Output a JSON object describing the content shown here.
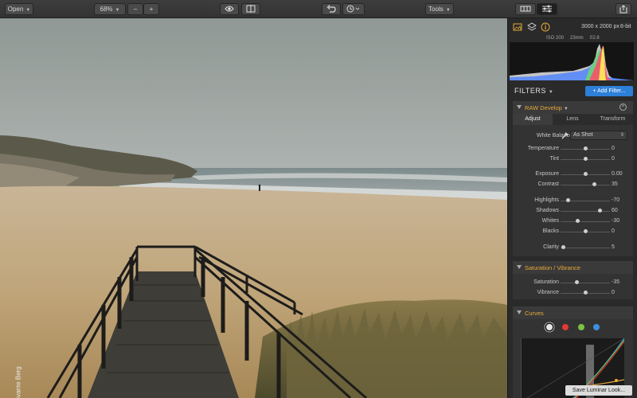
{
  "toolbar": {
    "open_label": "Open",
    "zoom_label": "68%",
    "zoom_minus": "–",
    "zoom_plus": "+",
    "tools_label": "Tools"
  },
  "photo": {
    "credit": "© Svante Berg"
  },
  "panel": {
    "dimensions": "3000 x 2000 px",
    "bit_depth": "8-bit",
    "iso": "ISO 200",
    "focal": "23mm",
    "aperture": "f/2.8",
    "filters_title": "FILTERS",
    "add_filter_label": "+ Add Filter..."
  },
  "raw_develop": {
    "title": "RAW Develop",
    "tabs": [
      "Adjust",
      "Lens",
      "Transform"
    ],
    "white_balance_label": "White Balance",
    "white_balance_value": "As Shot",
    "sliders": [
      {
        "label": "Temperature",
        "value": "0",
        "pos": 0.5
      },
      {
        "label": "Tint",
        "value": "0",
        "pos": 0.5
      },
      {
        "label": "Exposure",
        "value": "0.00",
        "pos": 0.5
      },
      {
        "label": "Contrast",
        "value": "35",
        "pos": 0.68
      },
      {
        "label": "Highlights",
        "value": "-70",
        "pos": 0.15
      },
      {
        "label": "Shadows",
        "value": "60",
        "pos": 0.8
      },
      {
        "label": "Whites",
        "value": "-30",
        "pos": 0.35
      },
      {
        "label": "Blacks",
        "value": "0",
        "pos": 0.5
      },
      {
        "label": "Clarity",
        "value": "5",
        "pos": 0.05
      }
    ]
  },
  "saturation": {
    "title": "Saturation / Vibrance",
    "sliders": [
      {
        "label": "Saturation",
        "value": "-35",
        "pos": 0.33
      },
      {
        "label": "Vibrance",
        "value": "0",
        "pos": 0.5
      }
    ]
  },
  "curves": {
    "title": "Curves",
    "channel_colors": [
      "#e6e6e6",
      "#e53935",
      "#7cc242",
      "#3d8fe0"
    ]
  },
  "save_look_label": "Save Luminar Look...",
  "colors": {
    "accent": "#e8a93a",
    "button_blue": "#2d7fd8"
  }
}
